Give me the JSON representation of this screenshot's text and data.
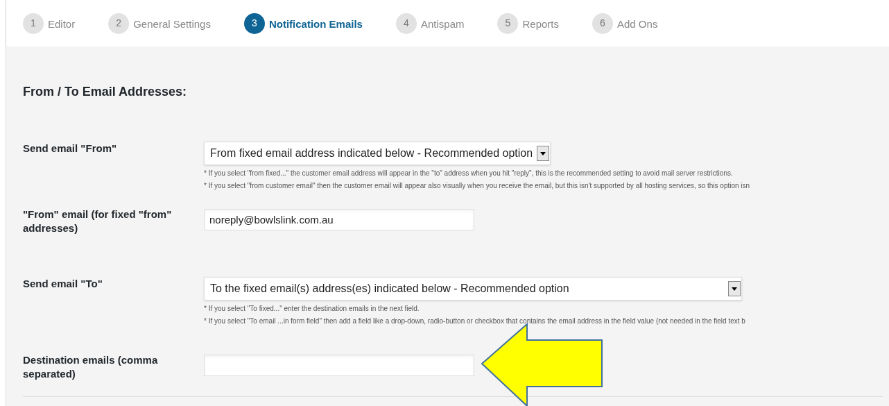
{
  "steps": [
    {
      "number": "1",
      "label": "Editor",
      "selected": false
    },
    {
      "number": "2",
      "label": "General Settings",
      "selected": false
    },
    {
      "number": "3",
      "label": "Notification Emails",
      "selected": true
    },
    {
      "number": "4",
      "label": "Antispam",
      "selected": false
    },
    {
      "number": "5",
      "label": "Reports",
      "selected": false
    },
    {
      "number": "6",
      "label": "Add Ons",
      "selected": false
    }
  ],
  "section_title": "From / To Email Addresses:",
  "fields": [
    {
      "kind": "select",
      "label": "Send email \"From\"",
      "value": "From fixed email address indicated below - Recommended option",
      "wide": false,
      "hints": [
        "* If you select \"from fixed...\" the customer email address will appear in the \"to\" address when you hit \"reply\", this is the recommended setting to avoid mail server restrictions.",
        "* If you select \"from customer email\" then the customer email will appear also visually when you receive the email, but this isn't supported by all hosting services, so this option isn"
      ]
    },
    {
      "kind": "text",
      "label": "\"From\" email (for fixed \"from\" addresses)",
      "value": "noreply@bowlslink.com.au"
    },
    {
      "kind": "select",
      "label": "Send email \"To\"",
      "value": "To the fixed email(s) address(es) indicated below - Recommended option",
      "wide": true,
      "hints": [
        "* If you select \"To fixed...\" enter the destination emails in the next field.",
        "* If you select \"To email ...in form field\" then add a field like a drop-down, radio-button or checkbox that contains the email address in the field value (not needed in the field text b"
      ]
    },
    {
      "kind": "text",
      "label": "Destination emails (comma separated)"
    }
  ]
}
